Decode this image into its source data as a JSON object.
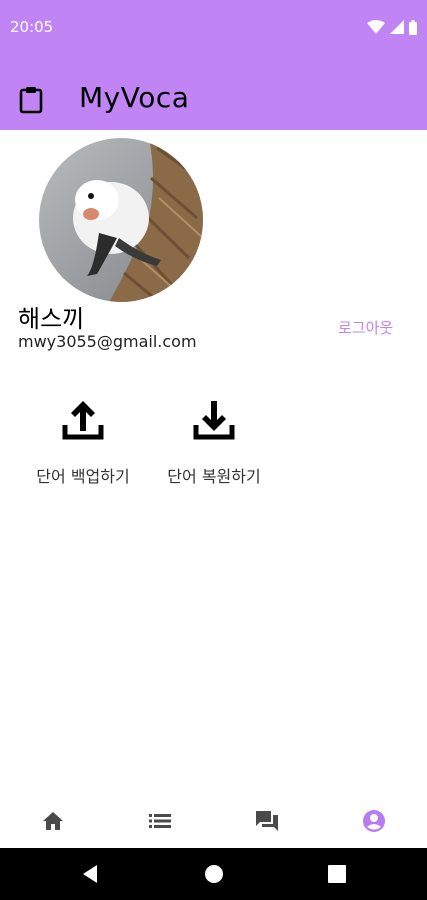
{
  "status_bar": {
    "time": "20:05",
    "icons": [
      "wifi-icon",
      "signal-icon",
      "battery-icon"
    ]
  },
  "app_bar": {
    "icon": "clipboard-icon",
    "title": "MyVoca"
  },
  "profile": {
    "name": "해스끼",
    "email": "mwy3055@gmail.com",
    "logout_label": "로그아웃",
    "avatar_desc": "bird-avatar"
  },
  "actions": [
    {
      "label": "단어 백업하기",
      "icon": "upload-icon"
    },
    {
      "label": "단어 복원하기",
      "icon": "download-icon"
    }
  ],
  "bottom_nav": {
    "items": [
      "home-icon",
      "list-icon",
      "forum-icon",
      "account-circle-icon"
    ],
    "active_index": 3
  },
  "colors": {
    "accent": "#c084f5",
    "nav_inactive": "#4a4a4a",
    "nav_active": "#b97cf0"
  }
}
